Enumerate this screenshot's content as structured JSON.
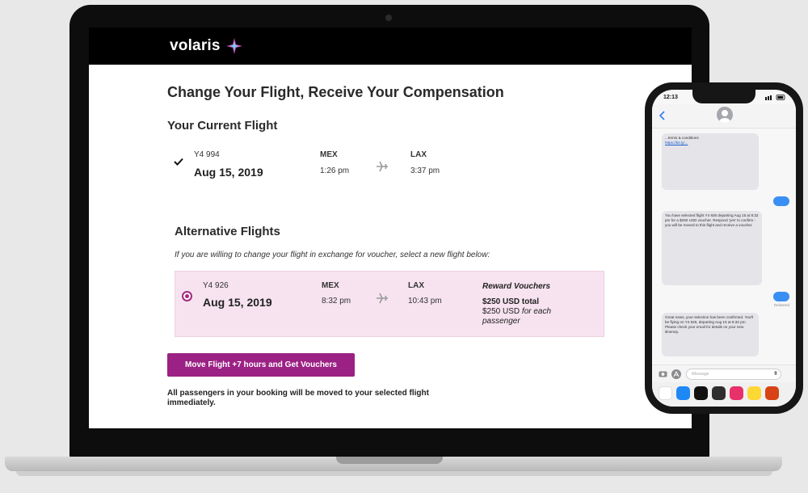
{
  "brand": {
    "name": "volaris"
  },
  "page": {
    "title": "Change Your Flight, Receive Your Compensation"
  },
  "current": {
    "section_title": "Your Current Flight",
    "flight_number": "Y4 994",
    "date": "Aug 15, 2019",
    "origin": "MEX",
    "depart_time": "1:26 pm",
    "destination": "LAX",
    "arrive_time": "3:37 pm"
  },
  "alternatives": {
    "section_title": "Alternative Flights",
    "instructions": "If you are willing to change your flight in exchange for voucher, select a new flight below:",
    "option": {
      "flight_number": "Y4 926",
      "date": "Aug 15, 2019",
      "origin": "MEX",
      "depart_time": "8:32 pm",
      "destination": "LAX",
      "arrive_time": "10:43 pm",
      "reward_title": "Reward Vouchers",
      "reward_total": "$250 USD total",
      "reward_each_amount": "$250 USD",
      "reward_each_suffix": "for each passenger"
    }
  },
  "action": {
    "button_label": "Move Flight +7 hours and Get Vouchers"
  },
  "footnote": "All passengers in your booking will be moved to your selected flight immediately.",
  "phone": {
    "time": "12:13",
    "messages": [
      {
        "type": "in",
        "text": "...terms & conditions",
        "link": "https://bit.ly/..."
      },
      {
        "type": "in",
        "text": "You have selected flight Y4 926 departing Aug 15 at 8:32 pm for a $250 USD voucher. Respond 'yes' to confirm - you will be moved to this flight and receive a voucher."
      },
      {
        "type": "in",
        "text": "Great news, your selection has been confirmed. You'll be flying on Y4 926, departing Aug 15 at 8:32 pm. Please check your email for details on your new itinerary."
      }
    ],
    "delivered_label": "Delivered",
    "input_placeholder": "iMessage"
  },
  "colors": {
    "accent": "#9b2184",
    "card": "#f6e3ef",
    "bubble_out": "#3a8ff5"
  }
}
